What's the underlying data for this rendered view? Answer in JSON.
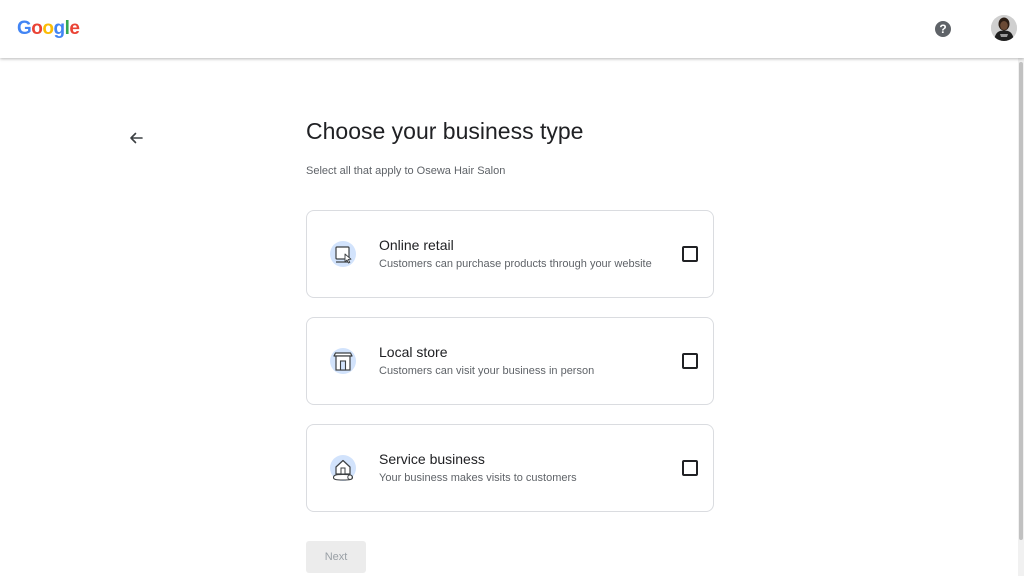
{
  "header": {
    "logo": {
      "letters": [
        "G",
        "o",
        "o",
        "g",
        "l",
        "e"
      ],
      "colors": [
        "#4285F4",
        "#EA4335",
        "#FBBC05",
        "#4285F4",
        "#34A853",
        "#EA4335"
      ]
    },
    "help_icon": "?"
  },
  "page": {
    "title": "Choose your business type",
    "subtitle": "Select all that apply to Osewa Hair Salon"
  },
  "options": [
    {
      "title": "Online retail",
      "description": "Customers can purchase products through your website",
      "icon": "online-retail-icon",
      "checked": false
    },
    {
      "title": "Local store",
      "description": "Customers can visit your business in person",
      "icon": "local-store-icon",
      "checked": false
    },
    {
      "title": "Service business",
      "description": "Your business makes visits to customers",
      "icon": "service-business-icon",
      "checked": false
    }
  ],
  "next_label": "Next",
  "colors": {
    "icon_bg": "#d2e3fc",
    "icon_stroke": "#3c4043",
    "disabled_button": "#ececec"
  }
}
